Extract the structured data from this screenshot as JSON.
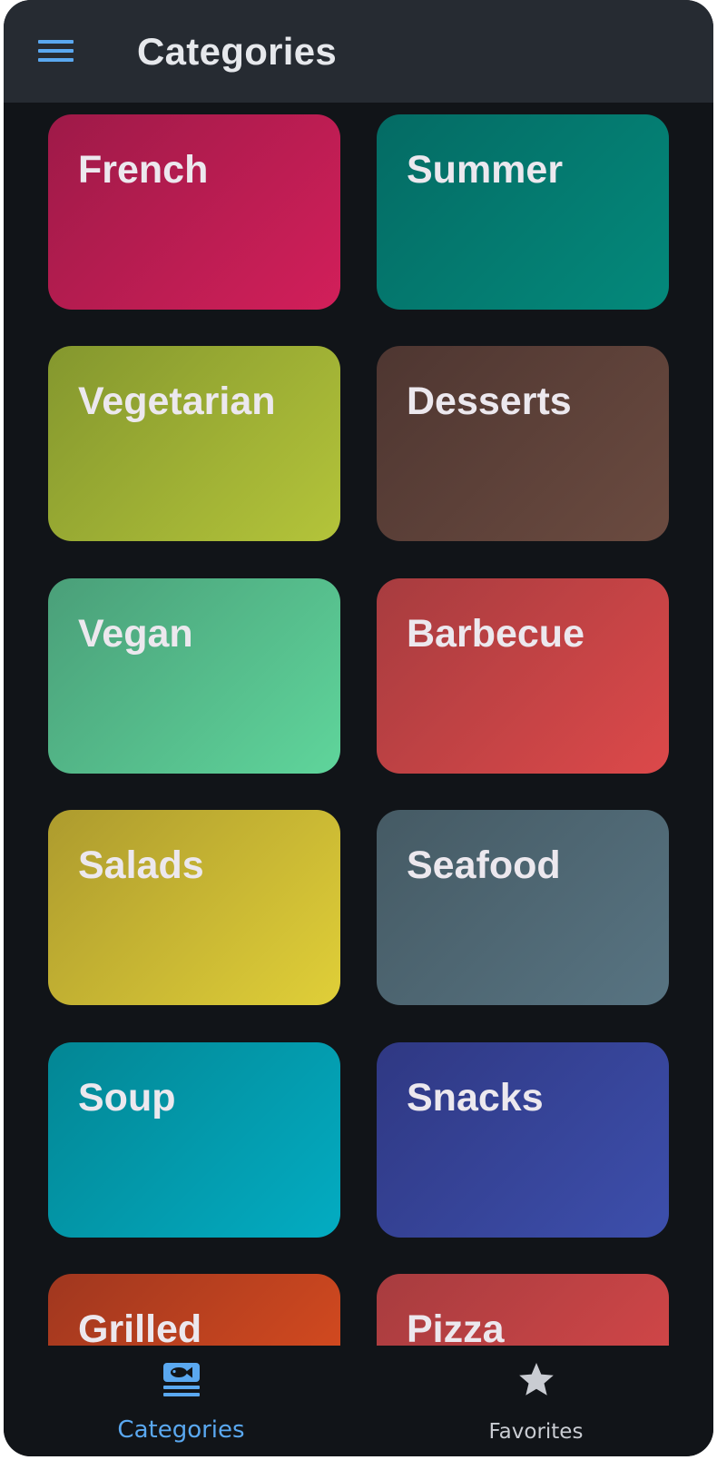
{
  "app_bar": {
    "title": "Categories",
    "menu_icon": "hamburger-menu-icon"
  },
  "categories": [
    {
      "label": "French",
      "colors": [
        "#9e1a48",
        "#d21f5a"
      ]
    },
    {
      "label": "Summer",
      "colors": [
        "#046b64",
        "#04897b"
      ]
    },
    {
      "label": "Vegetarian",
      "colors": [
        "#84972e",
        "#b4c43a"
      ]
    },
    {
      "label": "Desserts",
      "colors": [
        "#4e3631",
        "#6b4b40"
      ]
    },
    {
      "label": "Vegan",
      "colors": [
        "#4a9f79",
        "#5fd59b"
      ]
    },
    {
      "label": "Barbecue",
      "colors": [
        "#a73c3f",
        "#dc494a"
      ]
    },
    {
      "label": "Salads",
      "colors": [
        "#ad9b2e",
        "#e0cf38"
      ]
    },
    {
      "label": "Seafood",
      "colors": [
        "#455a64",
        "#587482"
      ]
    },
    {
      "label": "Soup",
      "colors": [
        "#038694",
        "#03acc2"
      ]
    },
    {
      "label": "Snacks",
      "colors": [
        "#2f3883",
        "#3d4fac"
      ]
    },
    {
      "label": "Grilled",
      "colors": [
        "#a0371f",
        "#e14f1f"
      ]
    },
    {
      "label": "Pizza",
      "colors": [
        "#a73c3f",
        "#dc494a"
      ]
    }
  ],
  "bottom_nav": {
    "items": [
      {
        "label": "Categories",
        "icon": "fish-dish-icon",
        "active": true,
        "color": "#5aa8f0"
      },
      {
        "label": "Favorites",
        "icon": "star-icon",
        "active": false,
        "color": "#c9ccd2"
      }
    ]
  }
}
